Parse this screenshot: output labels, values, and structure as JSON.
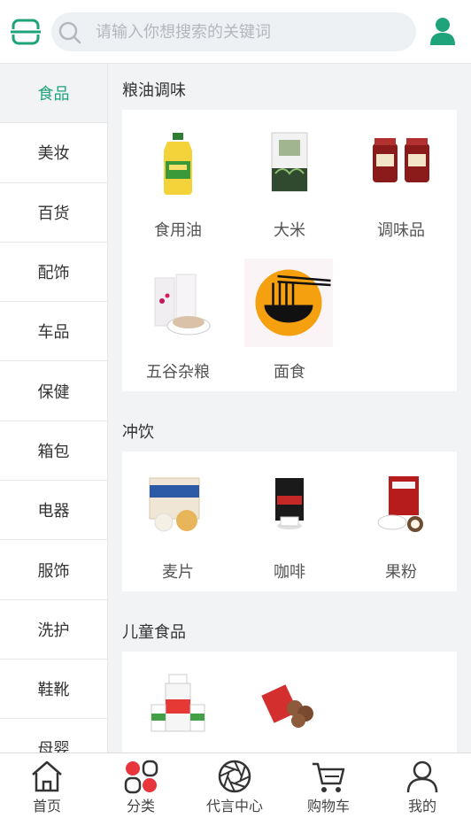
{
  "header": {
    "search_placeholder": "请输入你想搜索的关键词",
    "icons": {
      "scan": "scan-icon",
      "search": "search-icon",
      "user": "user-icon"
    },
    "accent_color": "#1fa37a"
  },
  "sidebar": {
    "items": [
      {
        "label": "食品",
        "active": true
      },
      {
        "label": "美妆"
      },
      {
        "label": "百货"
      },
      {
        "label": "配饰"
      },
      {
        "label": "车品"
      },
      {
        "label": "保健"
      },
      {
        "label": "箱包"
      },
      {
        "label": "电器"
      },
      {
        "label": "服饰"
      },
      {
        "label": "洗护"
      },
      {
        "label": "鞋靴"
      },
      {
        "label": "母婴"
      }
    ]
  },
  "sections": [
    {
      "title": "粮油调味",
      "items": [
        {
          "label": "食用油"
        },
        {
          "label": "大米"
        },
        {
          "label": "调味品"
        },
        {
          "label": "五谷杂粮"
        },
        {
          "label": "面食"
        }
      ]
    },
    {
      "title": "冲饮",
      "items": [
        {
          "label": "麦片"
        },
        {
          "label": "咖啡"
        },
        {
          "label": "果粉"
        }
      ]
    },
    {
      "title": "儿童食品",
      "items": [
        {
          "label": ""
        },
        {
          "label": ""
        }
      ]
    }
  ],
  "tabbar": {
    "tabs": [
      {
        "label": "首页",
        "icon": "home-icon"
      },
      {
        "label": "分类",
        "icon": "category-icon",
        "active": true,
        "active_color": "#e8343b"
      },
      {
        "label": "代言中心",
        "icon": "aperture-icon"
      },
      {
        "label": "购物车",
        "icon": "cart-icon"
      },
      {
        "label": "我的",
        "icon": "profile-icon"
      }
    ]
  }
}
